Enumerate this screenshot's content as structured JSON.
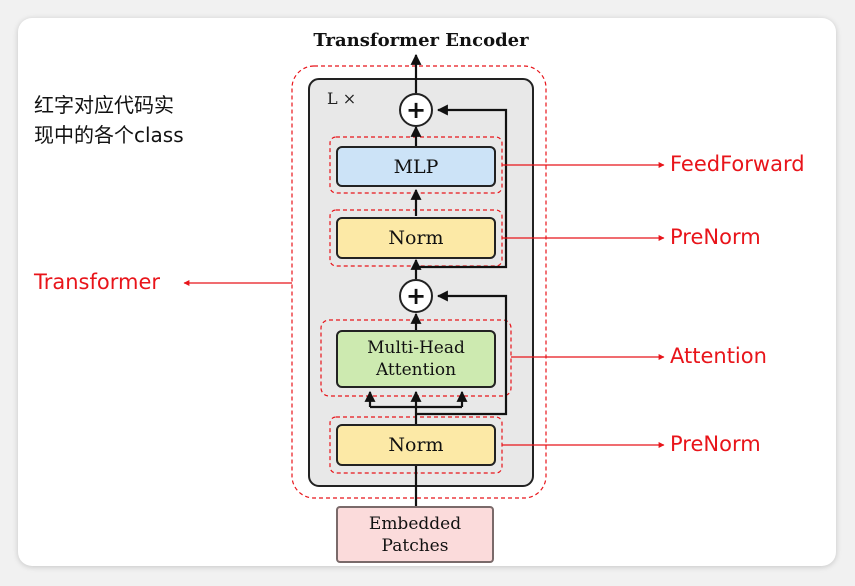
{
  "diagram": {
    "title": "Transformer Encoder",
    "repeat_label": "L ×",
    "note": "红字对应代码实\n现中的各个class",
    "blocks": {
      "mlp": "MLP",
      "norm_top": "Norm",
      "attention_line1": "Multi-Head",
      "attention_line2": "Attention",
      "norm_bottom": "Norm",
      "embedded_line1": "Embedded",
      "embedded_line2": "Patches"
    },
    "plus_symbol": "+",
    "class_labels": {
      "feedforward": "FeedForward",
      "prenorm_top": "PreNorm",
      "attention": "Attention",
      "prenorm_bottom": "PreNorm",
      "transformer": "Transformer"
    },
    "colors": {
      "label_red": "#e8141a",
      "norm_fill": "#fce9a6",
      "mlp_fill": "#cce3f7",
      "attention_fill": "#cdeab0",
      "embedded_fill": "#fbdbdb",
      "encoder_bg": "#e8e8e8"
    }
  }
}
